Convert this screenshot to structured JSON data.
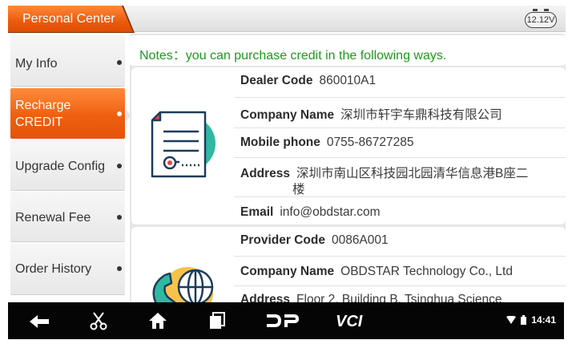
{
  "header": {
    "title": "Personal Center",
    "battery_voltage": "12.12V"
  },
  "sidebar": {
    "items": [
      {
        "label": "My Info",
        "active": false
      },
      {
        "label_line1": "Recharge",
        "label_line2": "CREDIT",
        "active": true
      },
      {
        "label": "Upgrade Config",
        "active": false
      },
      {
        "label": "Renewal Fee",
        "active": false
      },
      {
        "label": "Order History",
        "active": false
      }
    ]
  },
  "main": {
    "notes": "Notes：you can purchase credit in the following ways.",
    "dealer": {
      "icon": "document-certificate-icon",
      "rows": [
        {
          "key": "Dealer Code",
          "value": "860010A1"
        },
        {
          "key": "Company Name",
          "value": "深圳市轩宇车鼎科技有限公司"
        },
        {
          "key": "Mobile phone",
          "value": "0755-86727285"
        },
        {
          "key": "Address",
          "value_line1": "深圳市南山区科技园北园清华信息港B座二",
          "value_line2": "楼"
        },
        {
          "key": "Email",
          "value": "info@obdstar.com"
        }
      ]
    },
    "provider": {
      "icon": "phone-globe-icon",
      "rows": [
        {
          "key": "Provider Code",
          "value": "0086A001"
        },
        {
          "key": "Company Name",
          "value": "OBDSTAR Technology Co., Ltd"
        },
        {
          "key": "Address",
          "value": "Floor 2, Building B, Tsinghua Science"
        }
      ]
    }
  },
  "navbar": {
    "buttons": [
      "back-icon",
      "scissors-icon",
      "home-icon",
      "recent-apps-icon",
      "dp-icon",
      "vci-icon"
    ],
    "dp_label": "DP",
    "vci_label": "VCI",
    "time": "14:41"
  },
  "colors": {
    "accent": "#ef5f10",
    "notes_text": "#1d9a1d",
    "navbar": "#050505"
  }
}
